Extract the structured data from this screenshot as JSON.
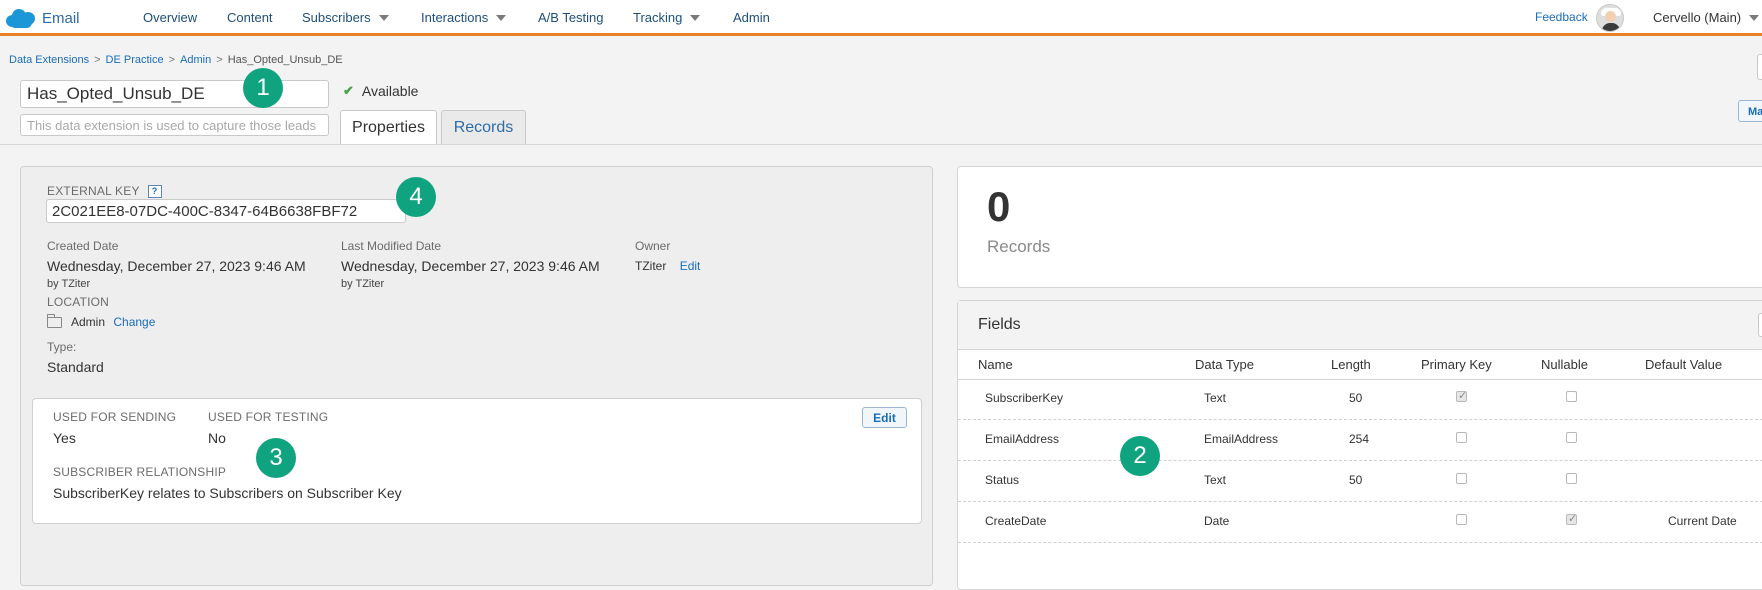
{
  "app": {
    "brand_label": "Email"
  },
  "nav": {
    "items": [
      "Overview",
      "Content",
      "Subscribers",
      "Interactions",
      "A/B Testing",
      "Tracking",
      "Admin"
    ],
    "feedback": "Feedback",
    "account": "Cervello (Main)"
  },
  "breadcrumb": [
    "Data Extensions",
    "DE Practice",
    "Admin",
    "Has_Opted_Unsub_DE"
  ],
  "header": {
    "name_value": "Has_Opted_Unsub_DE",
    "description_placeholder": "This data extension is used to capture those leads",
    "status": "Available",
    "tabs": [
      "Properties",
      "Records"
    ],
    "edge_button": "Ma"
  },
  "properties": {
    "external_key_label": "EXTERNAL KEY",
    "help_glyph": "?",
    "external_key_value": "2C021EE8-07DC-400C-8347-64B6638FBF72",
    "created_label": "Created Date",
    "created_value": "Wednesday, December 27, 2023 9:46 AM",
    "created_by": "by TZiter",
    "modified_label": "Last Modified Date",
    "modified_value": "Wednesday, December 27, 2023 9:46 AM",
    "modified_by": "by TZiter",
    "owner_label": "Owner",
    "owner_value": "TZiter",
    "owner_edit": "Edit",
    "location_label": "LOCATION",
    "location_value": "Admin",
    "location_change": "Change",
    "type_label": "Type:",
    "type_value": "Standard"
  },
  "sending": {
    "used_for_sending_label": "USED FOR SENDING",
    "used_for_sending_value": "Yes",
    "used_for_testing_label": "USED FOR TESTING",
    "used_for_testing_value": "No",
    "relationship_label": "SUBSCRIBER RELATIONSHIP",
    "relationship_value": "SubscriberKey relates to Subscribers on Subscriber Key",
    "edit_label": "Edit"
  },
  "records": {
    "count": "0",
    "label": "Records"
  },
  "fields": {
    "title": "Fields",
    "columns": [
      "Name",
      "Data Type",
      "Length",
      "Primary Key",
      "Nullable",
      "Default Value"
    ],
    "rows": [
      {
        "name": "SubscriberKey",
        "type": "Text",
        "length": "50",
        "primary_key": true,
        "nullable": false,
        "default": ""
      },
      {
        "name": "EmailAddress",
        "type": "EmailAddress",
        "length": "254",
        "primary_key": false,
        "nullable": false,
        "default": ""
      },
      {
        "name": "Status",
        "type": "Text",
        "length": "50",
        "primary_key": false,
        "nullable": false,
        "default": ""
      },
      {
        "name": "CreateDate",
        "type": "Date",
        "length": "",
        "primary_key": false,
        "nullable": true,
        "default": "Current Date"
      }
    ]
  },
  "badges": [
    "1",
    "2",
    "3",
    "4"
  ],
  "colors": {
    "accent_bar": "#e8822a",
    "badge": "#10a37f",
    "link": "#1a6cbb"
  }
}
